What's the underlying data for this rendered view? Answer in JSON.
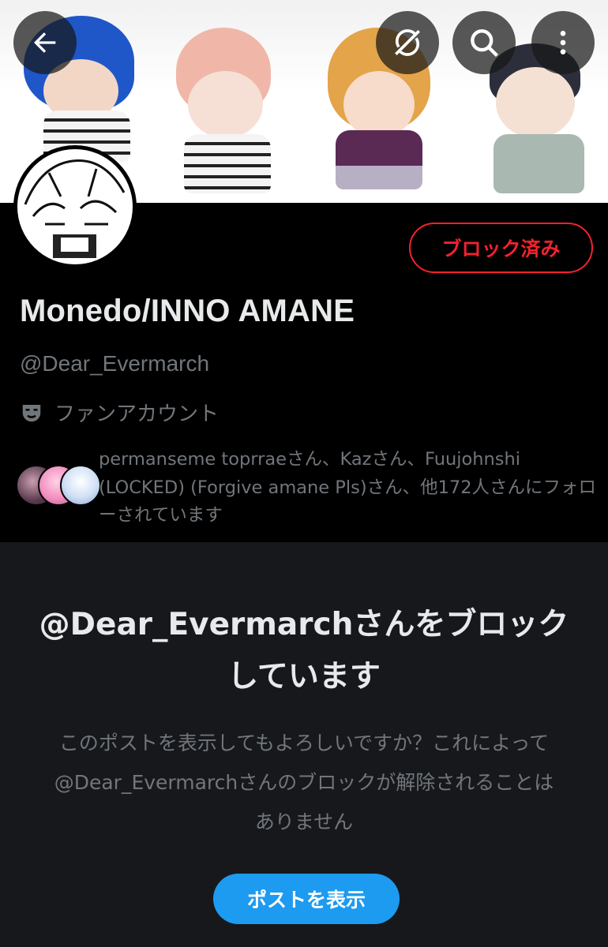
{
  "header": {
    "back_icon": "arrow-left-icon",
    "sync_icon": "translate-off-icon",
    "search_icon": "search-icon",
    "more_icon": "more-vertical-icon"
  },
  "profile": {
    "blocked_button_label": "ブロック済み",
    "display_name": "Monedo/INNO AMANE",
    "handle": "@Dear_Evermarch",
    "account_label": "ファンアカウント",
    "followed_by": "permanseme toprraeさん、Kazさん、Fuujohnshi (LOCKED) (Forgive amane Pls)さん、他172人さんにフォローされています"
  },
  "blocked_notice": {
    "title": "@Dear_Evermarchさんをブロックしています",
    "description": "このポストを表示してもよろしいですか？これによって@Dear_Evermarchさんのブロックが解除されることはありません",
    "view_button_label": "ポストを表示"
  },
  "colors": {
    "accent_blue": "#1d9bf0",
    "blocked_red": "#f4212e",
    "background": "#000000",
    "panel": "#16181c",
    "secondary_text": "#71767b"
  }
}
